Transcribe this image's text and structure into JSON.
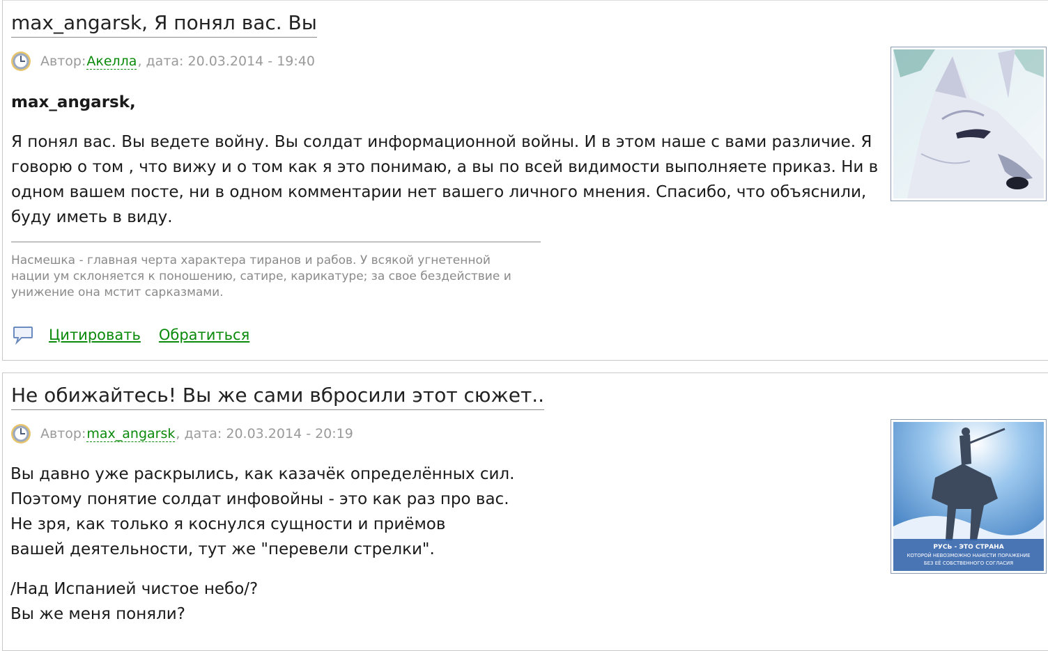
{
  "posts": [
    {
      "title": "max_angarsk, Я понял вас. Вы",
      "meta": {
        "author_prefix": "Автор: ",
        "author": "Акелла",
        "date_text": ", дата: 20.03.2014 - 19:40"
      },
      "addressee": "max_angarsk,",
      "body_lines": [
        "Я понял вас. Вы ведете войну. Вы солдат информационной войны. И в этом наше с вами различие. Я",
        "говорю о том , что вижу и о том как я это понимаю, а вы по всей видимости выполняете приказ. Ни в",
        "одном вашем посте, ни в одном комментарии нет вашего личного мнения. Спасибо, что объяснили,",
        "буду иметь в виду."
      ],
      "signature_lines": [
        "Насмешка - главная черта характера тиранов и рабов. У всякой угнетенной",
        "нации ум склоняется к поношению, сатире, карикатуре; за свое бездействие и",
        "унижение она мстит сарказмами."
      ],
      "actions": {
        "quote_label": "Цитировать",
        "reply_label": "Обратиться"
      },
      "avatar_icon": "wolf-avatar"
    },
    {
      "title": "Не обижайтесь! Вы же сами вбросили этот сюжет..",
      "meta": {
        "author_prefix": "Автор: ",
        "author": "max_angarsk",
        "date_text": ", дата: 20.03.2014 - 20:19"
      },
      "body_lines": [
        "Вы давно уже раскрылись, как казачёк определённых сил.",
        "Поэтому понятие солдат инфовойны - это как раз про вас.",
        "Не зря, как только я коснулся сущности и приёмов",
        "вашей деятельности, тут же \"перевели стрелки\"."
      ],
      "body_lines_2": [
        "/Над Испанией чистое небо/?",
        "Вы же меня поняли?"
      ],
      "avatar_icon": "horseman-statue-avatar",
      "avatar_caption": [
        "РУСЬ - ЭТО СТРАНА",
        "КОТОРОЙ НЕВОЗМОЖНО НАНЕСТИ ПОРАЖЕНИЕ",
        "БЕЗ ЕЁ СОБСТВЕННОГО СОГЛАСИЯ"
      ]
    }
  ],
  "colors": {
    "link": "#0a8a0a",
    "meta": "#9a9a9a",
    "signature": "#8a8a8a"
  }
}
